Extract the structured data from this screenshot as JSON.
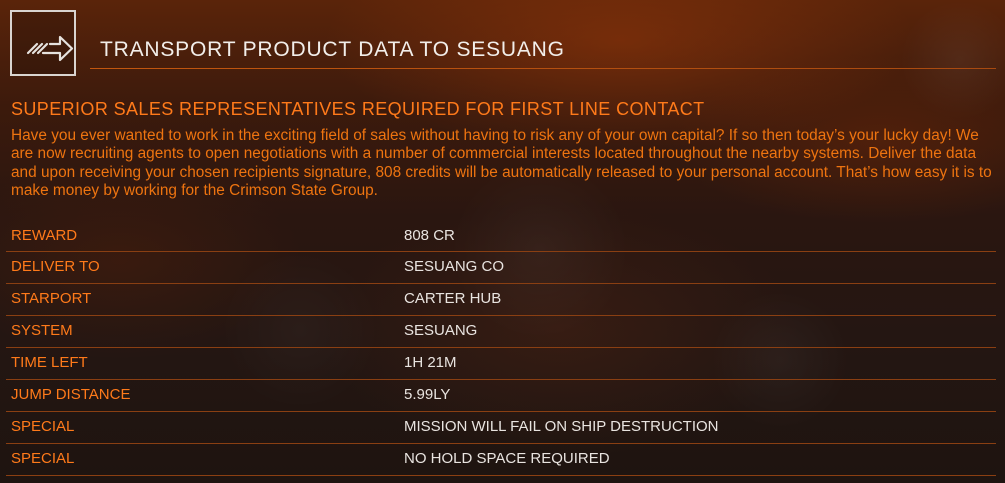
{
  "header": {
    "icon": "arrow-right-icon",
    "title": "TRANSPORT PRODUCT DATA TO SESUANG"
  },
  "mission": {
    "subtitle": "SUPERIOR SALES REPRESENTATIVES REQUIRED FOR FIRST LINE CONTACT",
    "description": "Have you ever wanted to work in the exciting field of sales without having to risk any of your own capital? If so then today’s your lucky day! We are now recruiting agents to open negotiations with a number of commercial interests located throughout the nearby systems. Deliver the data and upon receiving your chosen recipients signature, 808 credits will be automatically released to your personal account. That’s how easy it is to make money by working for the Crimson State Group."
  },
  "details": [
    {
      "label": "REWARD",
      "value": "808 CR"
    },
    {
      "label": "DELIVER TO",
      "value": "SESUANG CO"
    },
    {
      "label": "STARPORT",
      "value": "CARTER HUB"
    },
    {
      "label": "SYSTEM",
      "value": "SESUANG"
    },
    {
      "label": "TIME LEFT",
      "value": "1H 21M"
    },
    {
      "label": "JUMP DISTANCE",
      "value": "5.99LY"
    },
    {
      "label": "SPECIAL",
      "value": "MISSION WILL FAIL ON SHIP DESTRUCTION"
    },
    {
      "label": "SPECIAL",
      "value": "NO HOLD SPACE REQUIRED"
    }
  ],
  "colors": {
    "accent": "#ff7a1a",
    "body_text": "#ee7410",
    "value_text": "#e9e4e0",
    "title_text": "#f2eeea",
    "divider": "#8a3f12"
  }
}
